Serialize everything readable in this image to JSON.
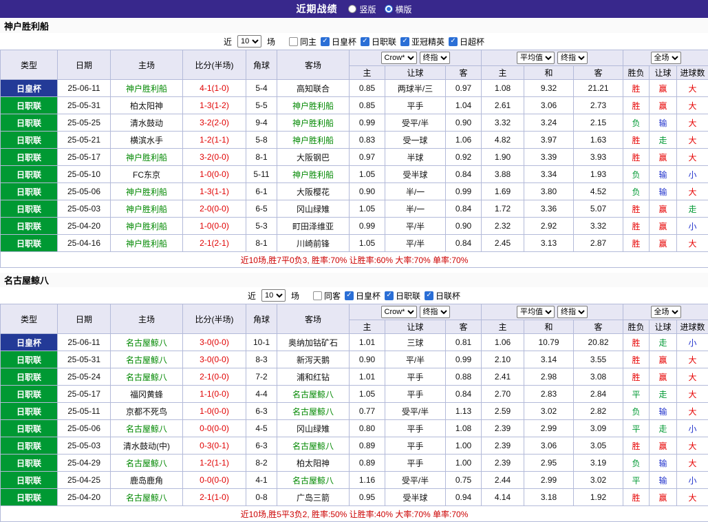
{
  "topbar": {
    "title": "近期战绩",
    "radios": [
      {
        "label": "竖版",
        "selected": false
      },
      {
        "label": "横版",
        "selected": true
      }
    ]
  },
  "table_header": {
    "left_cols": [
      "类型",
      "日期",
      "主场",
      "比分(半场)",
      "角球",
      "客场"
    ],
    "odds_group": {
      "selects": [
        "Crow*",
        "终指"
      ],
      "cols": [
        "主",
        "让球",
        "客"
      ]
    },
    "avg_group": {
      "selects": [
        "平均值",
        "终指"
      ],
      "cols": [
        "主",
        "和",
        "客"
      ]
    },
    "result_group": {
      "selects": [
        "全场"
      ],
      "cols": [
        "胜负",
        "让球",
        "进球数"
      ]
    }
  },
  "colors": {
    "topbar_bg": "#38288c",
    "league_bg": "#009933",
    "cup_bg": "#233a97",
    "focal_team": "#008800",
    "score_red": "#e00000",
    "result_red": "#e60000",
    "result_green": "#009933",
    "result_blue": "#2233cc",
    "summary_red": "#cc0000",
    "checkbox_blue": "#2b6fd6"
  },
  "sections": [
    {
      "team": "神户胜利船",
      "filter": {
        "prefix": "近",
        "count": "10",
        "suffix": "场",
        "venue": {
          "label": "同主",
          "checked": false
        },
        "competitions": [
          {
            "label": "日皇杯",
            "checked": true
          },
          {
            "label": "日职联",
            "checked": true
          },
          {
            "label": "亚冠精英",
            "checked": true
          },
          {
            "label": "日超杯",
            "checked": true
          }
        ]
      },
      "rows": [
        {
          "competition": "日皇杯",
          "is_cup": true,
          "date": "25-06-11",
          "home": "神户胜利船",
          "home_focal": true,
          "score": "4-1(1-0)",
          "corners": "5-4",
          "away": "高知联合",
          "away_focal": false,
          "odds": [
            "0.85",
            "两球半/三",
            "0.97"
          ],
          "avg": [
            "1.08",
            "9.32",
            "21.21"
          ],
          "results": [
            [
              "胜",
              "r"
            ],
            [
              "赢",
              "r"
            ],
            [
              "大",
              "r"
            ]
          ]
        },
        {
          "competition": "日职联",
          "is_cup": false,
          "date": "25-05-31",
          "home": "柏太阳神",
          "home_focal": false,
          "score": "1-3(1-2)",
          "corners": "5-5",
          "away": "神户胜利船",
          "away_focal": true,
          "odds": [
            "0.85",
            "平手",
            "1.04"
          ],
          "avg": [
            "2.61",
            "3.06",
            "2.73"
          ],
          "results": [
            [
              "胜",
              "r"
            ],
            [
              "赢",
              "r"
            ],
            [
              "大",
              "r"
            ]
          ]
        },
        {
          "competition": "日职联",
          "is_cup": false,
          "date": "25-05-25",
          "home": "清水鼓动",
          "home_focal": false,
          "score": "3-2(2-0)",
          "corners": "9-4",
          "away": "神户胜利船",
          "away_focal": true,
          "odds": [
            "0.99",
            "受平/半",
            "0.90"
          ],
          "avg": [
            "3.32",
            "3.24",
            "2.15"
          ],
          "results": [
            [
              "负",
              "g"
            ],
            [
              "输",
              "b"
            ],
            [
              "大",
              "r"
            ]
          ]
        },
        {
          "competition": "日职联",
          "is_cup": false,
          "date": "25-05-21",
          "home": "横滨水手",
          "home_focal": false,
          "score": "1-2(1-1)",
          "corners": "5-8",
          "away": "神户胜利船",
          "away_focal": true,
          "odds": [
            "0.83",
            "受一球",
            "1.06"
          ],
          "avg": [
            "4.82",
            "3.97",
            "1.63"
          ],
          "results": [
            [
              "胜",
              "r"
            ],
            [
              "走",
              "g"
            ],
            [
              "大",
              "r"
            ]
          ]
        },
        {
          "competition": "日职联",
          "is_cup": false,
          "date": "25-05-17",
          "home": "神户胜利船",
          "home_focal": true,
          "score": "3-2(0-0)",
          "corners": "8-1",
          "away": "大阪钢巴",
          "away_focal": false,
          "odds": [
            "0.97",
            "半球",
            "0.92"
          ],
          "avg": [
            "1.90",
            "3.39",
            "3.93"
          ],
          "results": [
            [
              "胜",
              "r"
            ],
            [
              "赢",
              "r"
            ],
            [
              "大",
              "r"
            ]
          ]
        },
        {
          "competition": "日职联",
          "is_cup": false,
          "date": "25-05-10",
          "home": "FC东京",
          "home_focal": false,
          "score": "1-0(0-0)",
          "corners": "5-11",
          "away": "神户胜利船",
          "away_focal": true,
          "odds": [
            "1.05",
            "受半球",
            "0.84"
          ],
          "avg": [
            "3.88",
            "3.34",
            "1.93"
          ],
          "results": [
            [
              "负",
              "g"
            ],
            [
              "输",
              "b"
            ],
            [
              "小",
              "b"
            ]
          ]
        },
        {
          "competition": "日职联",
          "is_cup": false,
          "date": "25-05-06",
          "home": "神户胜利船",
          "home_focal": true,
          "score": "1-3(1-1)",
          "corners": "6-1",
          "away": "大阪樱花",
          "away_focal": false,
          "odds": [
            "0.90",
            "半/一",
            "0.99"
          ],
          "avg": [
            "1.69",
            "3.80",
            "4.52"
          ],
          "results": [
            [
              "负",
              "g"
            ],
            [
              "输",
              "b"
            ],
            [
              "大",
              "r"
            ]
          ]
        },
        {
          "competition": "日职联",
          "is_cup": false,
          "date": "25-05-03",
          "home": "神户胜利船",
          "home_focal": true,
          "score": "2-0(0-0)",
          "corners": "6-5",
          "away": "冈山绿雉",
          "away_focal": false,
          "odds": [
            "1.05",
            "半/一",
            "0.84"
          ],
          "avg": [
            "1.72",
            "3.36",
            "5.07"
          ],
          "results": [
            [
              "胜",
              "r"
            ],
            [
              "赢",
              "r"
            ],
            [
              "走",
              "g"
            ]
          ]
        },
        {
          "competition": "日职联",
          "is_cup": false,
          "date": "25-04-20",
          "home": "神户胜利船",
          "home_focal": true,
          "score": "1-0(0-0)",
          "corners": "5-3",
          "away": "町田泽维亚",
          "away_focal": false,
          "odds": [
            "0.99",
            "平/半",
            "0.90"
          ],
          "avg": [
            "2.32",
            "2.92",
            "3.32"
          ],
          "results": [
            [
              "胜",
              "r"
            ],
            [
              "赢",
              "r"
            ],
            [
              "小",
              "b"
            ]
          ]
        },
        {
          "competition": "日职联",
          "is_cup": false,
          "date": "25-04-16",
          "home": "神户胜利船",
          "home_focal": true,
          "score": "2-1(2-1)",
          "corners": "8-1",
          "away": "川崎前锋",
          "away_focal": false,
          "odds": [
            "1.05",
            "平/半",
            "0.84"
          ],
          "avg": [
            "2.45",
            "3.13",
            "2.87"
          ],
          "results": [
            [
              "胜",
              "r"
            ],
            [
              "赢",
              "r"
            ],
            [
              "大",
              "r"
            ]
          ]
        }
      ],
      "summary": "近10场,胜7平0负3, 胜率:70% 让胜率:60% 大率:70% 单率:70%"
    },
    {
      "team": "名古屋鲸八",
      "filter": {
        "prefix": "近",
        "count": "10",
        "suffix": "场",
        "venue": {
          "label": "同客",
          "checked": false
        },
        "competitions": [
          {
            "label": "日皇杯",
            "checked": true
          },
          {
            "label": "日职联",
            "checked": true
          },
          {
            "label": "日联杯",
            "checked": true
          }
        ]
      },
      "rows": [
        {
          "competition": "日皇杯",
          "is_cup": true,
          "date": "25-06-11",
          "home": "名古屋鲸八",
          "home_focal": true,
          "score": "3-0(0-0)",
          "corners": "10-1",
          "away": "奥纳加钴矿石",
          "away_focal": false,
          "odds": [
            "1.01",
            "三球",
            "0.81"
          ],
          "avg": [
            "1.06",
            "10.79",
            "20.82"
          ],
          "results": [
            [
              "胜",
              "r"
            ],
            [
              "走",
              "g"
            ],
            [
              "小",
              "b"
            ]
          ]
        },
        {
          "competition": "日职联",
          "is_cup": false,
          "date": "25-05-31",
          "home": "名古屋鲸八",
          "home_focal": true,
          "score": "3-0(0-0)",
          "corners": "8-3",
          "away": "新泻天鹅",
          "away_focal": false,
          "odds": [
            "0.90",
            "平/半",
            "0.99"
          ],
          "avg": [
            "2.10",
            "3.14",
            "3.55"
          ],
          "results": [
            [
              "胜",
              "r"
            ],
            [
              "赢",
              "r"
            ],
            [
              "大",
              "r"
            ]
          ]
        },
        {
          "competition": "日职联",
          "is_cup": false,
          "date": "25-05-24",
          "home": "名古屋鲸八",
          "home_focal": true,
          "score": "2-1(0-0)",
          "corners": "7-2",
          "away": "浦和红钻",
          "away_focal": false,
          "odds": [
            "1.01",
            "平手",
            "0.88"
          ],
          "avg": [
            "2.41",
            "2.98",
            "3.08"
          ],
          "results": [
            [
              "胜",
              "r"
            ],
            [
              "赢",
              "r"
            ],
            [
              "大",
              "r"
            ]
          ]
        },
        {
          "competition": "日职联",
          "is_cup": false,
          "date": "25-05-17",
          "home": "福冈黄蜂",
          "home_focal": false,
          "score": "1-1(0-0)",
          "corners": "4-4",
          "away": "名古屋鲸八",
          "away_focal": true,
          "odds": [
            "1.05",
            "平手",
            "0.84"
          ],
          "avg": [
            "2.70",
            "2.83",
            "2.84"
          ],
          "results": [
            [
              "平",
              "g"
            ],
            [
              "走",
              "g"
            ],
            [
              "大",
              "r"
            ]
          ]
        },
        {
          "competition": "日职联",
          "is_cup": false,
          "date": "25-05-11",
          "home": "京都不死鸟",
          "home_focal": false,
          "score": "1-0(0-0)",
          "corners": "6-3",
          "away": "名古屋鲸八",
          "away_focal": true,
          "odds": [
            "0.77",
            "受平/半",
            "1.13"
          ],
          "avg": [
            "2.59",
            "3.02",
            "2.82"
          ],
          "results": [
            [
              "负",
              "g"
            ],
            [
              "输",
              "b"
            ],
            [
              "大",
              "r"
            ]
          ]
        },
        {
          "competition": "日职联",
          "is_cup": false,
          "date": "25-05-06",
          "home": "名古屋鲸八",
          "home_focal": true,
          "score": "0-0(0-0)",
          "corners": "4-5",
          "away": "冈山绿雉",
          "away_focal": false,
          "odds": [
            "0.80",
            "平手",
            "1.08"
          ],
          "avg": [
            "2.39",
            "2.99",
            "3.09"
          ],
          "results": [
            [
              "平",
              "g"
            ],
            [
              "走",
              "g"
            ],
            [
              "小",
              "b"
            ]
          ]
        },
        {
          "competition": "日职联",
          "is_cup": false,
          "date": "25-05-03",
          "home": "清水鼓动(中)",
          "home_focal": false,
          "score": "0-3(0-1)",
          "corners": "6-3",
          "away": "名古屋鲸八",
          "away_focal": true,
          "odds": [
            "0.89",
            "平手",
            "1.00"
          ],
          "avg": [
            "2.39",
            "3.06",
            "3.05"
          ],
          "results": [
            [
              "胜",
              "r"
            ],
            [
              "赢",
              "r"
            ],
            [
              "大",
              "r"
            ]
          ]
        },
        {
          "competition": "日职联",
          "is_cup": false,
          "date": "25-04-29",
          "home": "名古屋鲸八",
          "home_focal": true,
          "score": "1-2(1-1)",
          "corners": "8-2",
          "away": "柏太阳神",
          "away_focal": false,
          "odds": [
            "0.89",
            "平手",
            "1.00"
          ],
          "avg": [
            "2.39",
            "2.95",
            "3.19"
          ],
          "results": [
            [
              "负",
              "g"
            ],
            [
              "输",
              "b"
            ],
            [
              "大",
              "r"
            ]
          ]
        },
        {
          "competition": "日职联",
          "is_cup": false,
          "date": "25-04-25",
          "home": "鹿岛鹿角",
          "home_focal": false,
          "score": "0-0(0-0)",
          "corners": "4-1",
          "away": "名古屋鲸八",
          "away_focal": true,
          "odds": [
            "1.16",
            "受平/半",
            "0.75"
          ],
          "avg": [
            "2.44",
            "2.99",
            "3.02"
          ],
          "results": [
            [
              "平",
              "g"
            ],
            [
              "输",
              "b"
            ],
            [
              "小",
              "b"
            ]
          ]
        },
        {
          "competition": "日职联",
          "is_cup": false,
          "date": "25-04-20",
          "home": "名古屋鲸八",
          "home_focal": true,
          "score": "2-1(1-0)",
          "corners": "0-8",
          "away": "广岛三箭",
          "away_focal": false,
          "odds": [
            "0.95",
            "受半球",
            "0.94"
          ],
          "avg": [
            "4.14",
            "3.18",
            "1.92"
          ],
          "results": [
            [
              "胜",
              "r"
            ],
            [
              "赢",
              "r"
            ],
            [
              "大",
              "r"
            ]
          ]
        }
      ],
      "summary": "近10场,胜5平3负2, 胜率:50% 让胜率:40% 大率:70% 单率:70%"
    }
  ]
}
